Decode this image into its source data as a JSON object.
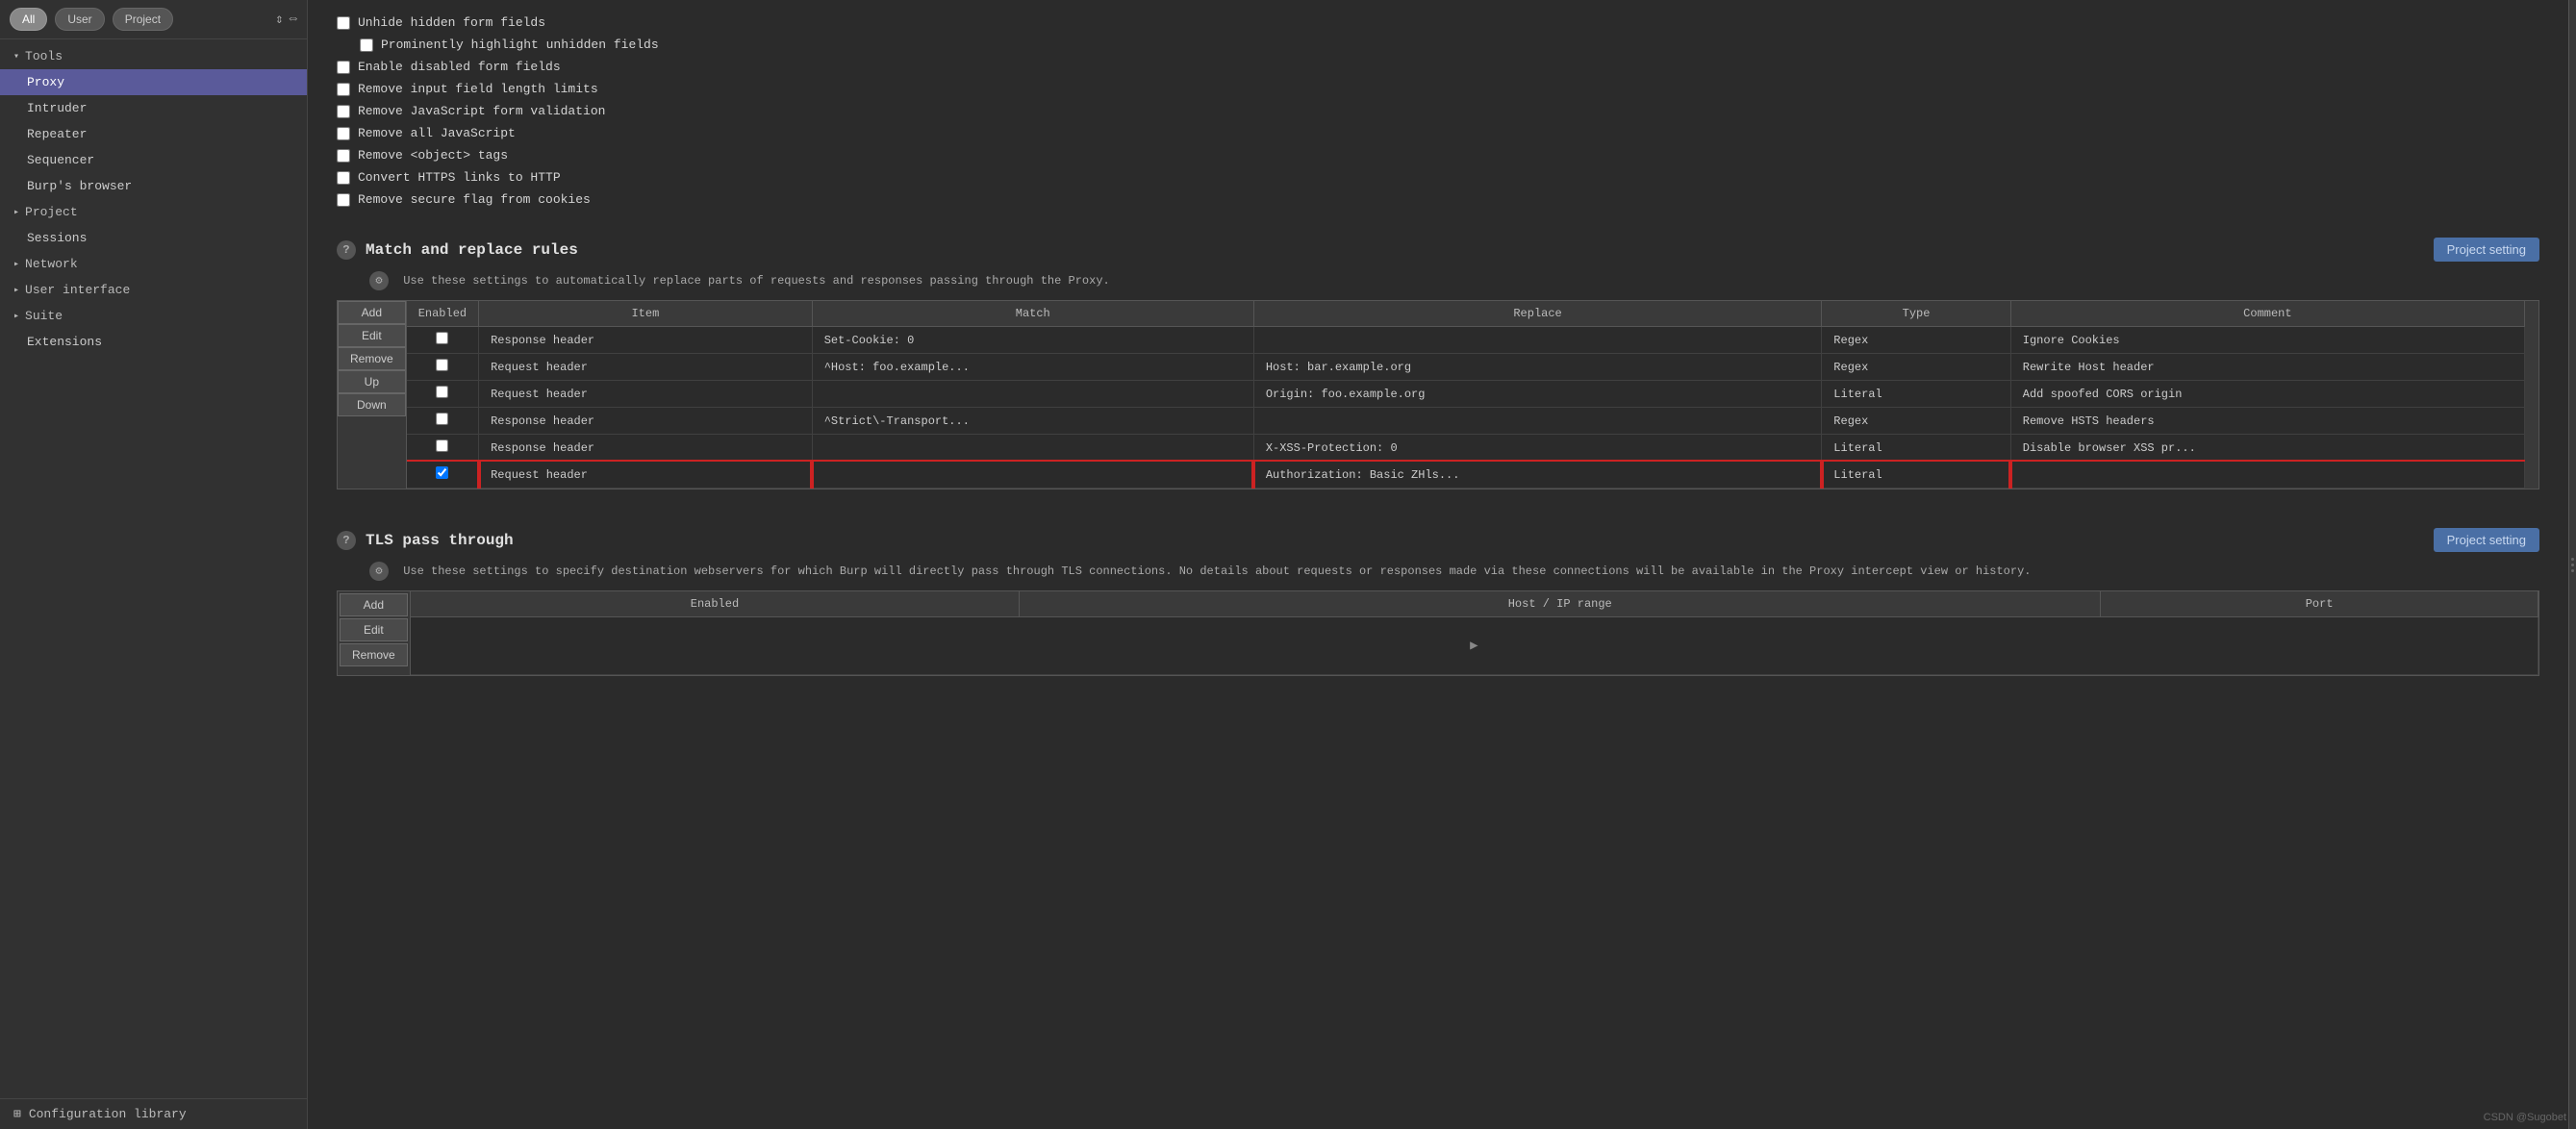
{
  "filter_buttons": [
    {
      "label": "All",
      "active": true
    },
    {
      "label": "User",
      "active": false
    },
    {
      "label": "Project",
      "active": false
    }
  ],
  "sidebar": {
    "tools_label": "Tools",
    "items": [
      {
        "label": "Proxy",
        "active": true
      },
      {
        "label": "Intruder",
        "active": false
      },
      {
        "label": "Repeater",
        "active": false
      },
      {
        "label": "Sequencer",
        "active": false
      },
      {
        "label": "Burp's browser",
        "active": false
      }
    ],
    "project_label": "Project",
    "project_items": [
      {
        "label": "Sessions",
        "active": false
      }
    ],
    "network_label": "Network",
    "user_interface_label": "User interface",
    "suite_label": "Suite",
    "suite_items": [
      {
        "label": "Extensions",
        "active": false
      }
    ],
    "config_library_label": "Configuration library"
  },
  "checkboxes": [
    {
      "label": "Unhide hidden form fields",
      "checked": false,
      "indented": false
    },
    {
      "label": "Prominently highlight unhidden fields",
      "checked": false,
      "indented": true
    },
    {
      "label": "Enable disabled form fields",
      "checked": false,
      "indented": false
    },
    {
      "label": "Remove input field length limits",
      "checked": false,
      "indented": false
    },
    {
      "label": "Remove JavaScript form validation",
      "checked": false,
      "indented": false
    },
    {
      "label": "Remove all JavaScript",
      "checked": false,
      "indented": false
    },
    {
      "label": "Remove <object> tags",
      "checked": false,
      "indented": false
    },
    {
      "label": "Convert HTTPS links to HTTP",
      "checked": false,
      "indented": false
    },
    {
      "label": "Remove secure flag from cookies",
      "checked": false,
      "indented": false
    }
  ],
  "match_replace": {
    "title": "Match and replace rules",
    "description": "Use these settings to automatically replace parts of requests and responses passing through the Proxy.",
    "project_setting_label": "Project setting",
    "buttons": [
      "Add",
      "Edit",
      "Remove",
      "Up",
      "Down"
    ],
    "columns": [
      "Enabled",
      "Item",
      "Match",
      "Replace",
      "Type",
      "Comment"
    ],
    "rows": [
      {
        "enabled": false,
        "item": "Response header",
        "match": "Set-Cookie: 0",
        "replace": "",
        "type": "Regex",
        "comment": "Ignore Cookies",
        "highlighted": false
      },
      {
        "enabled": false,
        "item": "Request header",
        "match": "^Host: foo.example...",
        "replace": "Host: bar.example.org",
        "type": "Regex",
        "comment": "Rewrite Host header",
        "highlighted": false
      },
      {
        "enabled": false,
        "item": "Request header",
        "match": "",
        "replace": "Origin: foo.example.org",
        "type": "Literal",
        "comment": "Add spoofed CORS origin",
        "highlighted": false
      },
      {
        "enabled": false,
        "item": "Response header",
        "match": "^Strict\\-Transport...",
        "replace": "",
        "type": "Regex",
        "comment": "Remove HSTS headers",
        "highlighted": false
      },
      {
        "enabled": false,
        "item": "Response header",
        "match": "",
        "replace": "X-XSS-Protection: 0",
        "type": "Literal",
        "comment": "Disable browser XSS pr...",
        "highlighted": false
      },
      {
        "enabled": true,
        "item": "Request header",
        "match": "",
        "replace": "Authorization: Basic ZHls...",
        "type": "Literal",
        "comment": "",
        "highlighted": true
      }
    ]
  },
  "tls_passthrough": {
    "title": "TLS pass through",
    "description": "Use these settings to specify destination webservers for which Burp will directly pass through TLS connections. No details about requests or responses made via these connections will be available in the Proxy intercept view or history.",
    "project_setting_label": "Project setting",
    "buttons": [
      "Add",
      "Edit",
      "Remove"
    ],
    "columns": [
      "Enabled",
      "Host / IP range",
      "Port"
    ],
    "rows": []
  },
  "watermark": "CSDN @Sugobet"
}
